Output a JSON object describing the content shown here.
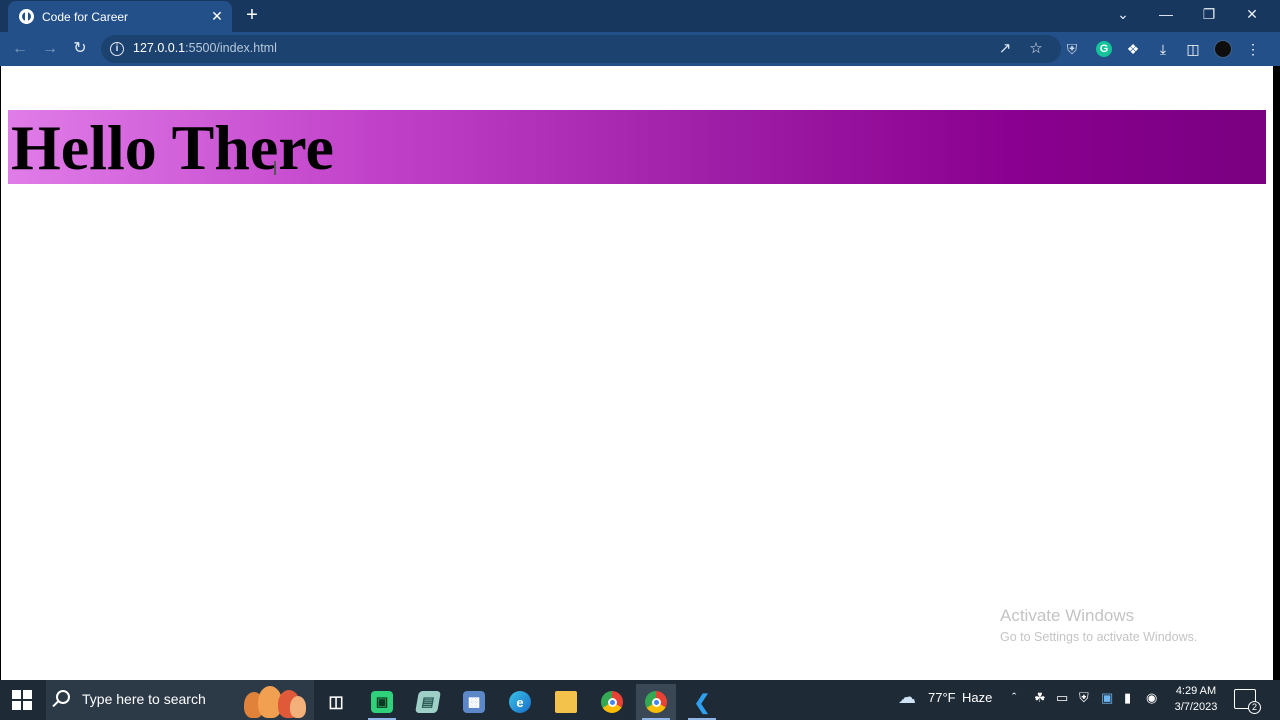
{
  "browser": {
    "tab_title": "Code for Career",
    "tab_close": "✕",
    "new_tab": "+",
    "url_host": "127.0.0.1",
    "url_path": ":5500/index.html",
    "window_controls": {
      "dropdown": "⌄",
      "minimize": "—",
      "restore": "❐",
      "close": "✕"
    }
  },
  "page": {
    "heading": "Hello There"
  },
  "watermark": {
    "line1": "Activate Windows",
    "line2": "Go to Settings to activate Windows."
  },
  "taskbar": {
    "search_placeholder": "Type here to search",
    "weather_temp": "77°F",
    "weather_text": "Haze",
    "time": "4:29 AM",
    "date": "3/7/2023",
    "notification_count": "2"
  },
  "colors": {
    "titlebar": "#17375f",
    "toolbar": "#24508a",
    "gradient_start": "#e07ce8",
    "gradient_end": "#790080",
    "taskbar": "#1e2a36"
  }
}
